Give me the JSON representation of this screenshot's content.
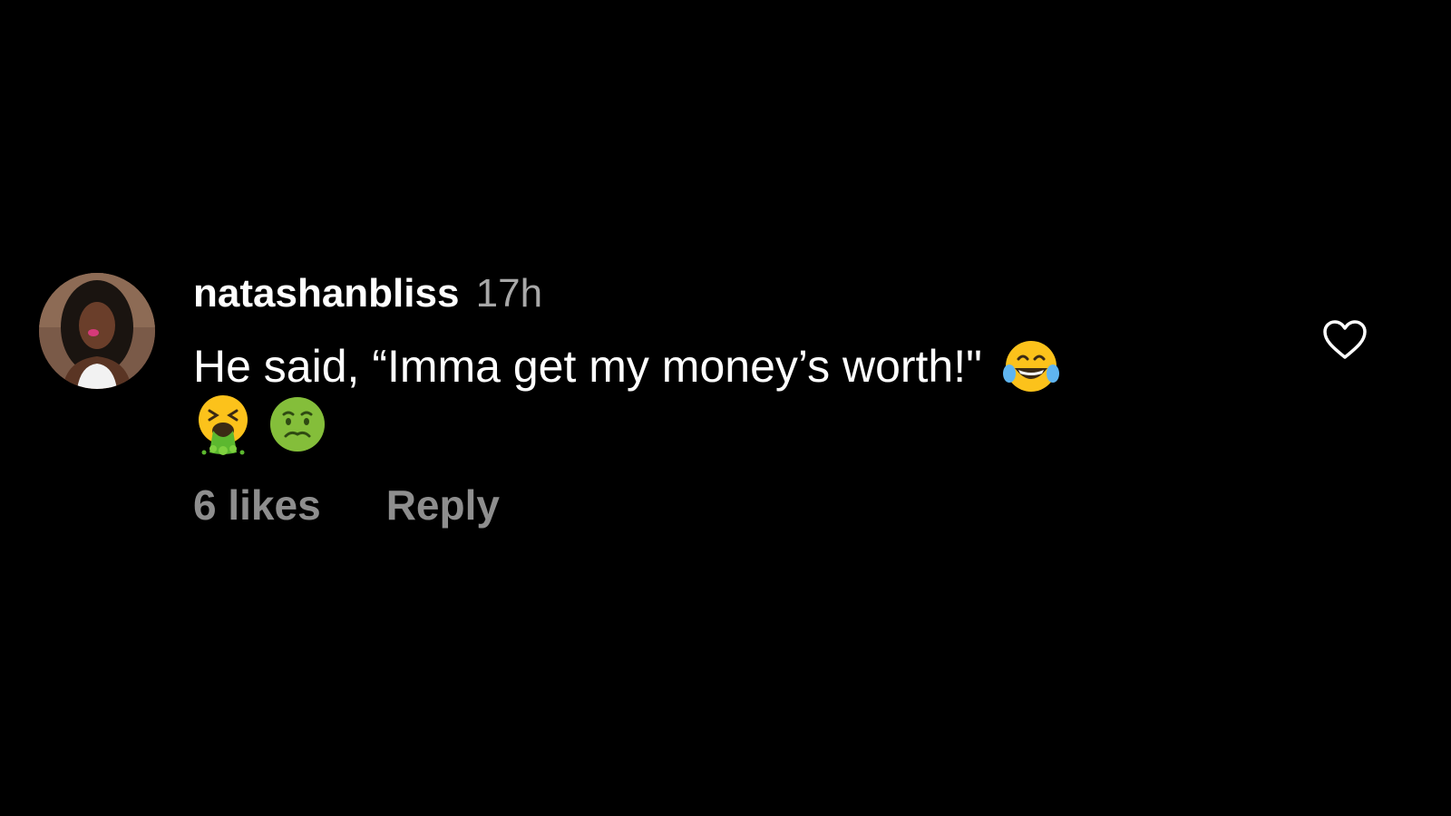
{
  "comment": {
    "username": "natashanbliss",
    "timestamp": "17h",
    "text": "He said, “Imma get my money’s worth!\"",
    "emoji_inline": "face-with-tears-of-joy",
    "emoji_row": [
      "face-vomiting",
      "nauseated-face"
    ],
    "likes_label": "6 likes",
    "reply_label": "Reply",
    "like_icon": "heart-outline-icon"
  },
  "colors": {
    "background": "#000000",
    "primary_text": "#ffffff",
    "secondary_text": "#a8a8a8",
    "action_text": "#8e8e8e"
  }
}
